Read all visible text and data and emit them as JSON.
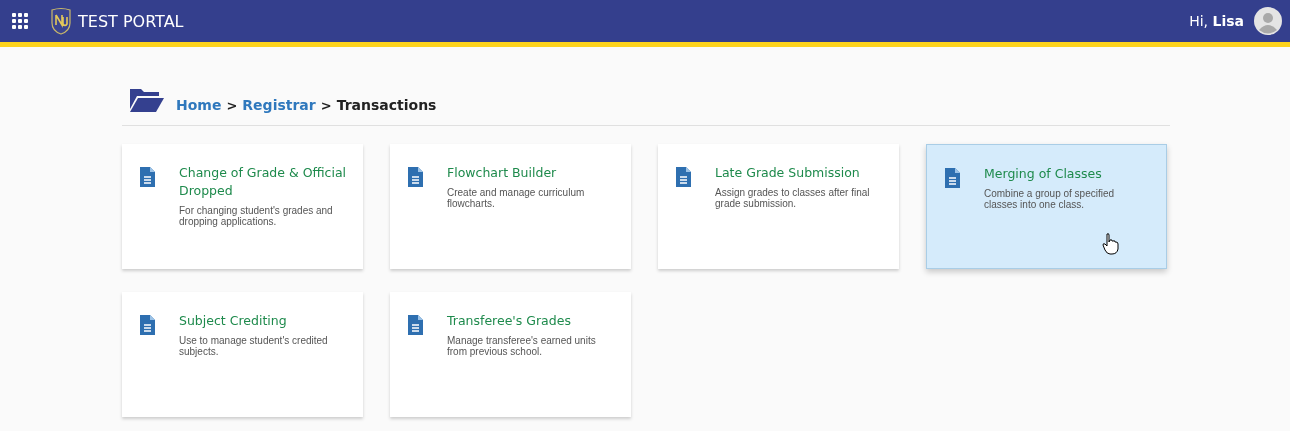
{
  "header": {
    "title": "TEST PORTAL",
    "greeting": "Hi,",
    "user": "Lisa"
  },
  "breadcrumb": [
    {
      "label": "Home",
      "kind": "link"
    },
    {
      "separator": ">",
      "label": "Registrar",
      "kind": "link"
    },
    {
      "separator": ">",
      "label": "Transactions",
      "kind": "current"
    }
  ],
  "cards": [
    {
      "title": "Change of Grade & Official Dropped",
      "description": "For changing student's grades and dropping applications.",
      "highlighted": false
    },
    {
      "title": "Flowchart Builder",
      "description": "Create and manage curriculum flowcharts.",
      "highlighted": false
    },
    {
      "title": "Late Grade Submission",
      "description": "Assign grades to classes after final grade submission.",
      "highlighted": false
    },
    {
      "title": "Merging of Classes",
      "description": "Combine a group of specified classes into one class.",
      "highlighted": true
    },
    {
      "title": "Subject Crediting",
      "description": "Use to manage student's credited subjects.",
      "highlighted": false
    },
    {
      "title": "Transferee's Grades",
      "description": "Manage transferee's earned units from previous school.",
      "highlighted": false
    }
  ]
}
